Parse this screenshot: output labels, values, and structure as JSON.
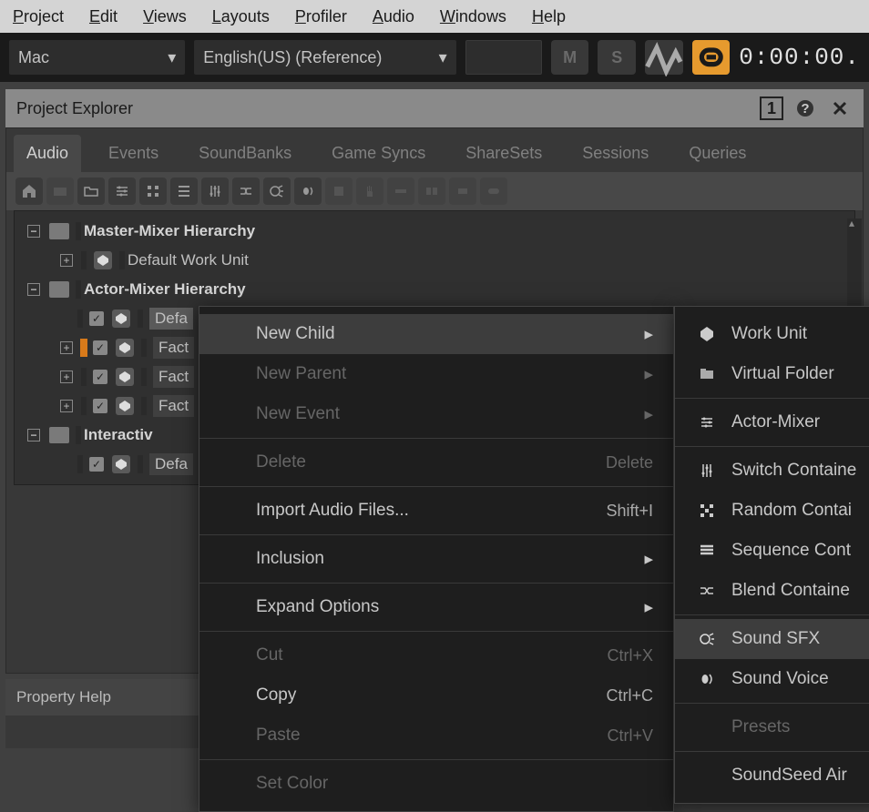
{
  "menubar": {
    "items": [
      {
        "hotkey": "P",
        "rest": "roject"
      },
      {
        "hotkey": "E",
        "rest": "dit"
      },
      {
        "hotkey": "V",
        "rest": "iews"
      },
      {
        "hotkey": "L",
        "rest": "ayouts"
      },
      {
        "hotkey": "P",
        "rest": "rofiler"
      },
      {
        "hotkey": "A",
        "rest": "udio"
      },
      {
        "hotkey": "W",
        "rest": "indows"
      },
      {
        "hotkey": "H",
        "rest": "elp"
      }
    ]
  },
  "subtoolbar": {
    "platform": "Mac",
    "language": "English(US) (Reference)",
    "btn_m": "M",
    "btn_s": "S",
    "timecode": "0:00:00."
  },
  "panel": {
    "title": "Project Explorer",
    "badge": "1"
  },
  "tabs": [
    "Audio",
    "Events",
    "SoundBanks",
    "Game Syncs",
    "ShareSets",
    "Sessions",
    "Queries"
  ],
  "active_tab": 0,
  "tree": {
    "rows": [
      {
        "text": "Master-Mixer Hierarchy"
      },
      {
        "text": "Default Work Unit"
      },
      {
        "text": "Actor-Mixer Hierarchy"
      },
      {
        "text": "Defa"
      },
      {
        "text": "Fact"
      },
      {
        "text": "Fact"
      },
      {
        "text": "Fact"
      },
      {
        "text": "Interactiv"
      },
      {
        "text": "Defa"
      }
    ]
  },
  "ctx": {
    "items": [
      {
        "label": "New Child",
        "arrow": true,
        "hover": true
      },
      {
        "label": "New Parent",
        "arrow": true,
        "disabled": true
      },
      {
        "label": "New Event",
        "arrow": true,
        "disabled": true
      },
      {
        "sep": true
      },
      {
        "label": "Delete",
        "shortcut": "Delete",
        "disabled": true
      },
      {
        "sep": true
      },
      {
        "label": "Import Audio Files...",
        "shortcut": "Shift+I"
      },
      {
        "sep": true
      },
      {
        "label": "Inclusion",
        "arrow": true
      },
      {
        "sep": true
      },
      {
        "label": "Expand Options",
        "arrow": true
      },
      {
        "sep": true
      },
      {
        "label": "Cut",
        "shortcut": "Ctrl+X",
        "disabled": true
      },
      {
        "label": "Copy",
        "shortcut": "Ctrl+C"
      },
      {
        "label": "Paste",
        "shortcut": "Ctrl+V",
        "disabled": true
      },
      {
        "sep": true
      },
      {
        "label": "Set Color",
        "disabled": true
      }
    ]
  },
  "subctx": {
    "items": [
      {
        "label": "Work Unit",
        "icon": "work-unit-icon"
      },
      {
        "label": "Virtual Folder",
        "icon": "folder-icon"
      },
      {
        "sep": true
      },
      {
        "label": "Actor-Mixer",
        "icon": "actor-mixer-icon"
      },
      {
        "sep": true
      },
      {
        "label": "Switch Containe",
        "icon": "switch-container-icon"
      },
      {
        "label": "Random Contai",
        "icon": "random-container-icon"
      },
      {
        "label": "Sequence Cont",
        "icon": "sequence-container-icon"
      },
      {
        "label": "Blend Containe",
        "icon": "blend-container-icon"
      },
      {
        "sep": true
      },
      {
        "label": "Sound SFX",
        "icon": "sound-sfx-icon",
        "hover": true
      },
      {
        "label": "Sound Voice",
        "icon": "sound-voice-icon"
      },
      {
        "sep": true
      },
      {
        "label": "Presets",
        "disabled": true
      },
      {
        "sep": true
      },
      {
        "label": "SoundSeed Air",
        "disabled": false
      }
    ]
  },
  "help": {
    "title": "Property Help",
    "body": ""
  }
}
